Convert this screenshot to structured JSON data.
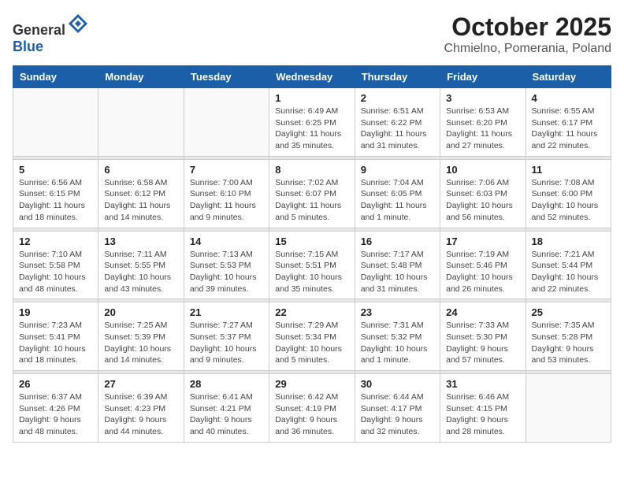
{
  "header": {
    "logo_general": "General",
    "logo_blue": "Blue",
    "month": "October 2025",
    "location": "Chmielno, Pomerania, Poland"
  },
  "weekdays": [
    "Sunday",
    "Monday",
    "Tuesday",
    "Wednesday",
    "Thursday",
    "Friday",
    "Saturday"
  ],
  "weeks": [
    [
      {
        "day": "",
        "info": ""
      },
      {
        "day": "",
        "info": ""
      },
      {
        "day": "",
        "info": ""
      },
      {
        "day": "1",
        "info": "Sunrise: 6:49 AM\nSunset: 6:25 PM\nDaylight: 11 hours\nand 35 minutes."
      },
      {
        "day": "2",
        "info": "Sunrise: 6:51 AM\nSunset: 6:22 PM\nDaylight: 11 hours\nand 31 minutes."
      },
      {
        "day": "3",
        "info": "Sunrise: 6:53 AM\nSunset: 6:20 PM\nDaylight: 11 hours\nand 27 minutes."
      },
      {
        "day": "4",
        "info": "Sunrise: 6:55 AM\nSunset: 6:17 PM\nDaylight: 11 hours\nand 22 minutes."
      }
    ],
    [
      {
        "day": "5",
        "info": "Sunrise: 6:56 AM\nSunset: 6:15 PM\nDaylight: 11 hours\nand 18 minutes."
      },
      {
        "day": "6",
        "info": "Sunrise: 6:58 AM\nSunset: 6:12 PM\nDaylight: 11 hours\nand 14 minutes."
      },
      {
        "day": "7",
        "info": "Sunrise: 7:00 AM\nSunset: 6:10 PM\nDaylight: 11 hours\nand 9 minutes."
      },
      {
        "day": "8",
        "info": "Sunrise: 7:02 AM\nSunset: 6:07 PM\nDaylight: 11 hours\nand 5 minutes."
      },
      {
        "day": "9",
        "info": "Sunrise: 7:04 AM\nSunset: 6:05 PM\nDaylight: 11 hours\nand 1 minute."
      },
      {
        "day": "10",
        "info": "Sunrise: 7:06 AM\nSunset: 6:03 PM\nDaylight: 10 hours\nand 56 minutes."
      },
      {
        "day": "11",
        "info": "Sunrise: 7:08 AM\nSunset: 6:00 PM\nDaylight: 10 hours\nand 52 minutes."
      }
    ],
    [
      {
        "day": "12",
        "info": "Sunrise: 7:10 AM\nSunset: 5:58 PM\nDaylight: 10 hours\nand 48 minutes."
      },
      {
        "day": "13",
        "info": "Sunrise: 7:11 AM\nSunset: 5:55 PM\nDaylight: 10 hours\nand 43 minutes."
      },
      {
        "day": "14",
        "info": "Sunrise: 7:13 AM\nSunset: 5:53 PM\nDaylight: 10 hours\nand 39 minutes."
      },
      {
        "day": "15",
        "info": "Sunrise: 7:15 AM\nSunset: 5:51 PM\nDaylight: 10 hours\nand 35 minutes."
      },
      {
        "day": "16",
        "info": "Sunrise: 7:17 AM\nSunset: 5:48 PM\nDaylight: 10 hours\nand 31 minutes."
      },
      {
        "day": "17",
        "info": "Sunrise: 7:19 AM\nSunset: 5:46 PM\nDaylight: 10 hours\nand 26 minutes."
      },
      {
        "day": "18",
        "info": "Sunrise: 7:21 AM\nSunset: 5:44 PM\nDaylight: 10 hours\nand 22 minutes."
      }
    ],
    [
      {
        "day": "19",
        "info": "Sunrise: 7:23 AM\nSunset: 5:41 PM\nDaylight: 10 hours\nand 18 minutes."
      },
      {
        "day": "20",
        "info": "Sunrise: 7:25 AM\nSunset: 5:39 PM\nDaylight: 10 hours\nand 14 minutes."
      },
      {
        "day": "21",
        "info": "Sunrise: 7:27 AM\nSunset: 5:37 PM\nDaylight: 10 hours\nand 9 minutes."
      },
      {
        "day": "22",
        "info": "Sunrise: 7:29 AM\nSunset: 5:34 PM\nDaylight: 10 hours\nand 5 minutes."
      },
      {
        "day": "23",
        "info": "Sunrise: 7:31 AM\nSunset: 5:32 PM\nDaylight: 10 hours\nand 1 minute."
      },
      {
        "day": "24",
        "info": "Sunrise: 7:33 AM\nSunset: 5:30 PM\nDaylight: 9 hours\nand 57 minutes."
      },
      {
        "day": "25",
        "info": "Sunrise: 7:35 AM\nSunset: 5:28 PM\nDaylight: 9 hours\nand 53 minutes."
      }
    ],
    [
      {
        "day": "26",
        "info": "Sunrise: 6:37 AM\nSunset: 4:26 PM\nDaylight: 9 hours\nand 48 minutes."
      },
      {
        "day": "27",
        "info": "Sunrise: 6:39 AM\nSunset: 4:23 PM\nDaylight: 9 hours\nand 44 minutes."
      },
      {
        "day": "28",
        "info": "Sunrise: 6:41 AM\nSunset: 4:21 PM\nDaylight: 9 hours\nand 40 minutes."
      },
      {
        "day": "29",
        "info": "Sunrise: 6:42 AM\nSunset: 4:19 PM\nDaylight: 9 hours\nand 36 minutes."
      },
      {
        "day": "30",
        "info": "Sunrise: 6:44 AM\nSunset: 4:17 PM\nDaylight: 9 hours\nand 32 minutes."
      },
      {
        "day": "31",
        "info": "Sunrise: 6:46 AM\nSunset: 4:15 PM\nDaylight: 9 hours\nand 28 minutes."
      },
      {
        "day": "",
        "info": ""
      }
    ]
  ]
}
